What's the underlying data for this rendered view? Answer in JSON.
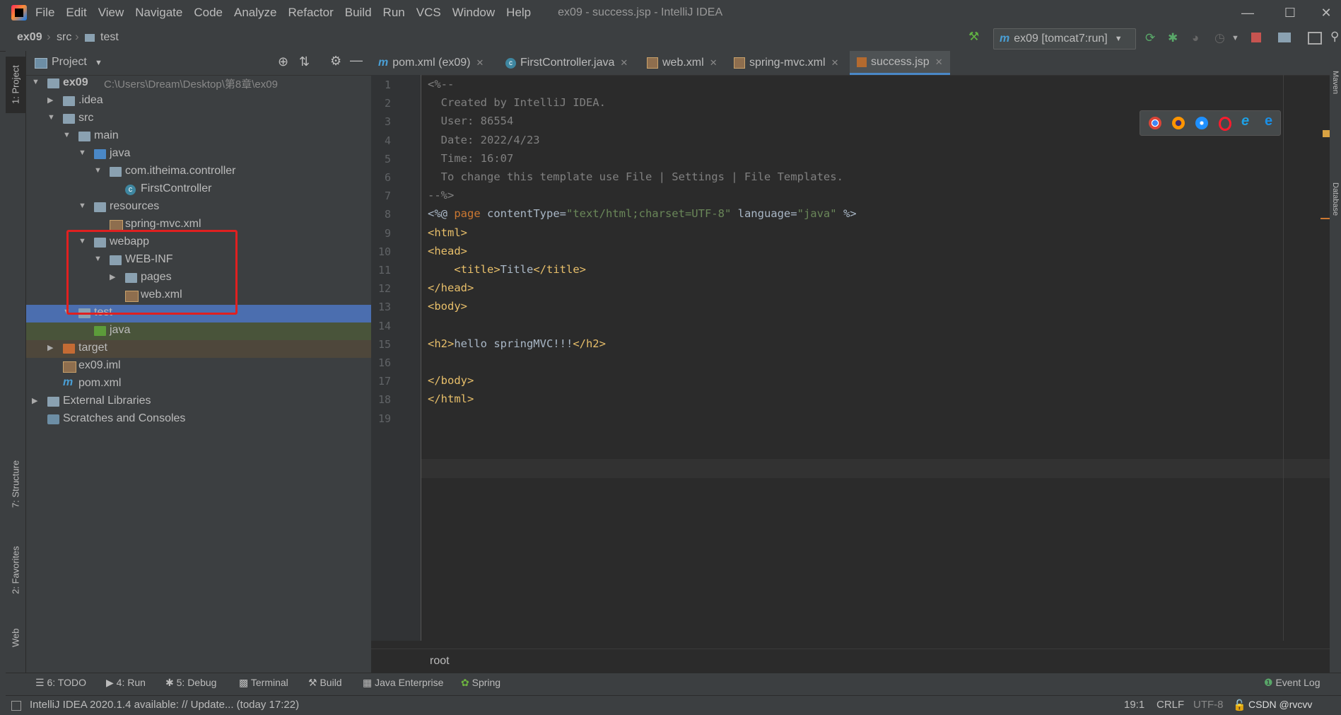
{
  "menubar": {
    "items": [
      "File",
      "Edit",
      "View",
      "Navigate",
      "Code",
      "Analyze",
      "Refactor",
      "Build",
      "Run",
      "VCS",
      "Window",
      "Help"
    ],
    "window_title": "ex09 - success.jsp - IntelliJ IDEA"
  },
  "navbar": {
    "crumbs": [
      "ex09",
      "src",
      "test"
    ],
    "run_config": "ex09 [tomcat7:run]"
  },
  "left_strip": {
    "project": "1: Project",
    "structure": "7: Structure",
    "favorites": "2: Favorites",
    "web": "Web"
  },
  "project_panel": {
    "title": "Project",
    "tree": [
      {
        "label": "ex09",
        "suffix": "C:\\Users\\Dream\\Desktop\\第8章\\ex09",
        "depth": 0,
        "arrow": "down",
        "icon": "module-folder-icon"
      },
      {
        "label": ".idea",
        "depth": 1,
        "arrow": "right",
        "icon": "folder-icon"
      },
      {
        "label": "src",
        "depth": 1,
        "arrow": "down",
        "icon": "folder-icon"
      },
      {
        "label": "main",
        "depth": 2,
        "arrow": "down",
        "icon": "folder-icon"
      },
      {
        "label": "java",
        "depth": 3,
        "arrow": "down",
        "icon": "source-folder-icon"
      },
      {
        "label": "com.itheima.controller",
        "depth": 4,
        "arrow": "down",
        "icon": "package-icon"
      },
      {
        "label": "FirstController",
        "depth": 5,
        "arrow": "",
        "icon": "class-icon"
      },
      {
        "label": "resources",
        "depth": 3,
        "arrow": "down",
        "icon": "resources-folder-icon"
      },
      {
        "label": "spring-mvc.xml",
        "depth": 4,
        "arrow": "",
        "icon": "xml-file-icon"
      },
      {
        "label": "webapp",
        "depth": 3,
        "arrow": "down",
        "icon": "web-folder-icon"
      },
      {
        "label": "WEB-INF",
        "depth": 4,
        "arrow": "down",
        "icon": "folder-icon"
      },
      {
        "label": "pages",
        "depth": 5,
        "arrow": "right",
        "icon": "folder-icon"
      },
      {
        "label": "web.xml",
        "depth": 5,
        "arrow": "",
        "icon": "xml-file-icon"
      },
      {
        "label": "test",
        "depth": 2,
        "arrow": "down",
        "icon": "test-folder-icon",
        "selected": true
      },
      {
        "label": "java",
        "depth": 3,
        "arrow": "",
        "icon": "test-source-folder-icon",
        "tint": "green"
      },
      {
        "label": "target",
        "depth": 1,
        "arrow": "right",
        "icon": "excluded-folder-icon",
        "tint": "orange"
      },
      {
        "label": "ex09.iml",
        "depth": 1,
        "arrow": "",
        "icon": "iml-file-icon"
      },
      {
        "label": "pom.xml",
        "depth": 1,
        "arrow": "",
        "icon": "maven-file-icon"
      },
      {
        "label": "External Libraries",
        "depth": 0,
        "arrow": "right",
        "icon": "libraries-icon"
      },
      {
        "label": "Scratches and Consoles",
        "depth": 0,
        "arrow": "",
        "icon": "scratches-icon"
      }
    ]
  },
  "editor": {
    "tabs": [
      {
        "label": "pom.xml (ex09)",
        "icon": "maven-file-icon"
      },
      {
        "label": "FirstController.java",
        "icon": "class-icon"
      },
      {
        "label": "web.xml",
        "icon": "xml-file-icon"
      },
      {
        "label": "spring-mvc.xml",
        "icon": "xml-file-icon"
      },
      {
        "label": "success.jsp",
        "icon": "jsp-file-icon",
        "active": true
      }
    ],
    "lines": [
      [
        [
          "c-comment",
          "<%--"
        ]
      ],
      [
        [
          "c-comment",
          "  Created by IntelliJ IDEA."
        ]
      ],
      [
        [
          "c-comment",
          "  User: 86554"
        ]
      ],
      [
        [
          "c-comment",
          "  Date: 2022/4/23"
        ]
      ],
      [
        [
          "c-comment",
          "  Time: 16:07"
        ]
      ],
      [
        [
          "c-comment",
          "  To change this template use File | Settings | File Templates."
        ]
      ],
      [
        [
          "c-comment",
          "--%>"
        ]
      ],
      [
        [
          "c-text",
          "<%@ "
        ],
        [
          "c-kw",
          "page "
        ],
        [
          "c-text",
          "contentType="
        ],
        [
          "c-str",
          "\"text/html;charset=UTF-8\""
        ],
        [
          "c-text",
          " language="
        ],
        [
          "c-str",
          "\"java\""
        ],
        [
          "c-text",
          " %>"
        ]
      ],
      [
        [
          "c-tag",
          "<html>"
        ]
      ],
      [
        [
          "c-tag",
          "<head>"
        ]
      ],
      [
        [
          "c-text",
          "    "
        ],
        [
          "c-tag",
          "<title>"
        ],
        [
          "c-text",
          "Title"
        ],
        [
          "c-tag",
          "</title>"
        ]
      ],
      [
        [
          "c-tag",
          "</head>"
        ]
      ],
      [
        [
          "c-tag",
          "<body>"
        ]
      ],
      [
        [
          "c-text",
          ""
        ]
      ],
      [
        [
          "c-tag",
          "<h2>"
        ],
        [
          "c-text",
          "hello springMVC!!!"
        ],
        [
          "c-tag",
          "</h2>"
        ]
      ],
      [
        [
          "c-text",
          ""
        ]
      ],
      [
        [
          "c-tag",
          "</body>"
        ]
      ],
      [
        [
          "c-tag",
          "</html>"
        ]
      ],
      [
        [
          "c-text",
          ""
        ]
      ]
    ],
    "breadcrumb": "root"
  },
  "bottom_tools": {
    "todo": "6: TODO",
    "run": "4: Run",
    "debug": "5: Debug",
    "terminal": "Terminal",
    "build": "Build",
    "java_enterprise": "Java Enterprise",
    "spring": "Spring",
    "event_log": "Event Log"
  },
  "statusbar": {
    "message": "IntelliJ IDEA 2020.1.4 available: // Update... (today 17:22)",
    "position": "19:1",
    "line_sep": "CRLF",
    "encoding": "UTF-8",
    "watermark": "CSDN @rvcvv"
  }
}
